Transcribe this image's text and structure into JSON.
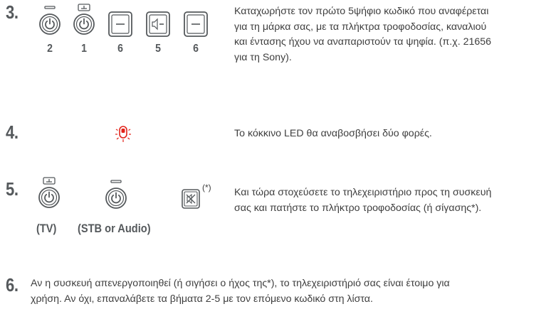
{
  "steps": [
    {
      "number": "3.",
      "text": "Καταχωρήστε τον πρώτο 5ψήφιο κωδικό που αναφέρεται για τη μάρκα σας, με τα πλήκτρα τροφοδοσίας, καναλιού και έντασης ήχου να αναπαριστούν τα ψηφία. (π.χ. 21656 για τη Sony).",
      "lines": [
        "Καταχωρήστε τον πρώτο 5ψήφιο κωδικό που αναφέρεται",
        "για τη μάρκα σας, με τα πλήκτρα τροφοδοσίας, καναλιού",
        "και έντασης ήχου να αναπαριστούν τα ψηφία. (π.χ. 21656",
        "για τη Sony)."
      ],
      "digits": [
        "2",
        "1",
        "6",
        "5",
        "6"
      ],
      "icons": [
        "power-stb-icon",
        "power-tv-icon",
        "channel-key-icon",
        "volume-key-icon",
        "channel-key-icon"
      ]
    },
    {
      "number": "4.",
      "text": "Το κόκκινο LED θα αναβοσβήσει δύο φορές.",
      "icons": [
        "red-led-icon"
      ]
    },
    {
      "number": "5.",
      "text": "Και τώρα στοχεύσετε το τηλεχειριστήριο προς τη συσκευή σας και πατήστε το πλήκτρο τροφοδοσίας (ή σίγασης*).",
      "lines": [
        "Και τώρα στοχεύσετε το τηλεχειριστήριο προς τη συσκευή",
        "σας και πατήστε το πλήκτρο τροφοδοσίας (ή σίγασης*)."
      ],
      "captions": [
        "(TV)",
        "(STB or Audio)"
      ],
      "asterisk": "(*)",
      "icons": [
        "power-tv-icon",
        "power-stb-icon",
        "mute-icon"
      ]
    },
    {
      "number": "6.",
      "text": "Αν η συσκευή απενεργοποιηθεί (ή σιγήσει ο ήχος της*), το τηλεχειριστήριό σας είναι έτοιμο για χρήση. Αν όχι, επαναλάβετε τα βήματα 2-5 με τον επόμενο κωδικό στη λίστα.",
      "lines": [
        "Αν η συσκευή απενεργοποιηθεί (ή σιγήσει ο ήχος της*), το τηλεχειριστήριό σας είναι έτοιμο για",
        "χρήση. Αν όχι, επαναλάβετε τα βήματα 2-5 με τον επόμενο κωδικό στη λίστα."
      ]
    }
  ],
  "colors": {
    "text": "#3e3e3e",
    "icon_stroke": "#55595c",
    "led_red": "#e2231a"
  }
}
